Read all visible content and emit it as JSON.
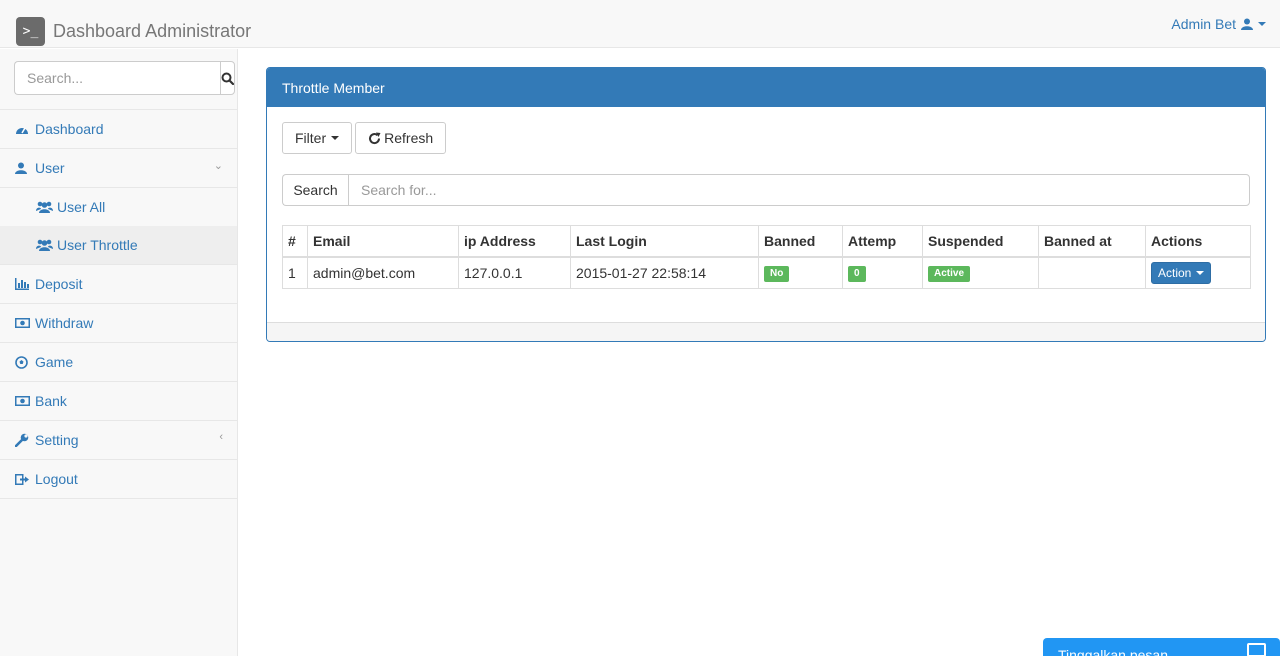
{
  "navbar": {
    "brand_icon": ">_",
    "title": "Dashboard Administrator",
    "user_label": "Admin Bet"
  },
  "sidebar": {
    "search_placeholder": "Search...",
    "items": [
      {
        "label": "Dashboard",
        "icon": "dashboard-icon"
      },
      {
        "label": "User",
        "icon": "user-icon",
        "expanded": true,
        "children": [
          {
            "label": "User All",
            "icon": "users-icon",
            "active": false
          },
          {
            "label": "User Throttle",
            "icon": "users-icon",
            "active": true
          }
        ]
      },
      {
        "label": "Deposit",
        "icon": "bar-chart-icon"
      },
      {
        "label": "Withdraw",
        "icon": "money-icon"
      },
      {
        "label": "Game",
        "icon": "soccer-ball-icon"
      },
      {
        "label": "Bank",
        "icon": "money-icon"
      },
      {
        "label": "Setting",
        "icon": "wrench-icon",
        "expanded": false
      },
      {
        "label": "Logout",
        "icon": "sign-out-icon"
      }
    ]
  },
  "panel": {
    "title": "Throttle Member",
    "filter_label": "Filter",
    "refresh_label": "Refresh",
    "search_addon": "Search",
    "search_placeholder": "Search for..."
  },
  "table": {
    "headers": [
      "#",
      "Email",
      "ip Address",
      "Last Login",
      "Banned",
      "Attemp",
      "Suspended",
      "Banned at",
      "Actions"
    ],
    "rows": [
      {
        "num": "1",
        "email": "admin@bet.com",
        "ip": "127.0.0.1",
        "last_login": "2015-01-27 22:58:14",
        "banned": "No",
        "attempt": "0",
        "suspended": "Active",
        "banned_at": "",
        "action": "Action"
      }
    ]
  },
  "chat": {
    "label": "Tinggalkan pesan"
  },
  "colors": {
    "primary": "#337ab7",
    "success": "#5cb85c",
    "chat": "#2196f3"
  }
}
